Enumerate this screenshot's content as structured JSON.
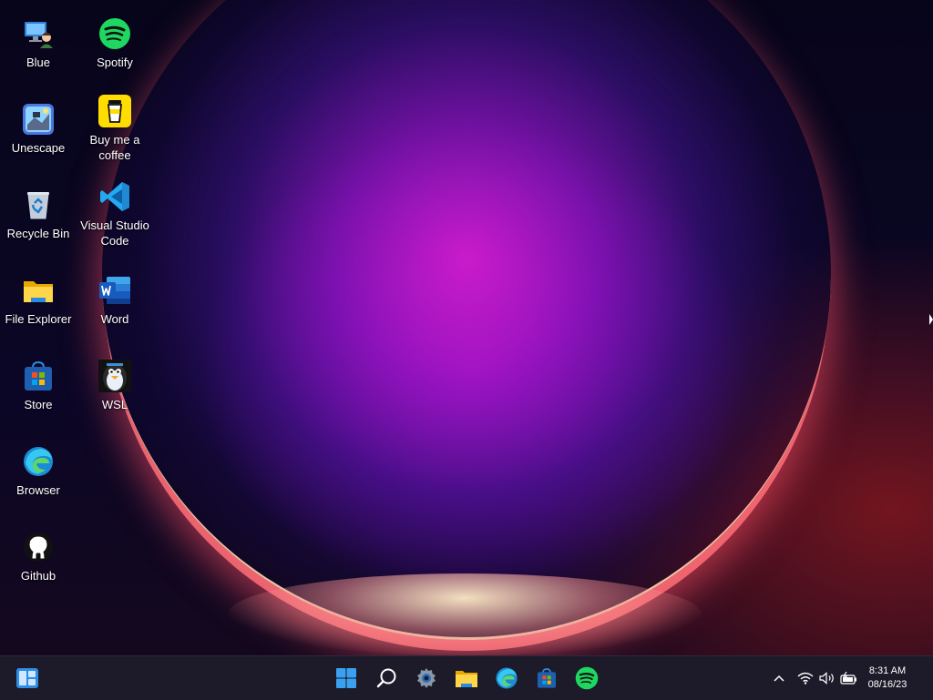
{
  "desktop": {
    "icons": [
      {
        "label": "Blue",
        "icon": "blue-computer-icon"
      },
      {
        "label": "Unescape",
        "icon": "unescape-icon"
      },
      {
        "label": "Recycle Bin",
        "icon": "recycle-bin-icon"
      },
      {
        "label": "File Explorer",
        "icon": "folder-icon"
      },
      {
        "label": "Store",
        "icon": "store-icon"
      },
      {
        "label": "Browser",
        "icon": "edge-icon"
      },
      {
        "label": "Github",
        "icon": "github-icon"
      },
      {
        "label": "Spotify",
        "icon": "spotify-icon"
      },
      {
        "label": "Buy me a coffee",
        "icon": "coffee-icon"
      },
      {
        "label": "Visual Studio Code",
        "icon": "vscode-icon"
      },
      {
        "label": "Word",
        "icon": "word-icon"
      },
      {
        "label": "WSL",
        "icon": "penguin-icon"
      }
    ]
  },
  "taskbar": {
    "apps": [
      "widgets",
      "start",
      "search",
      "settings",
      "file-explorer",
      "edge",
      "store",
      "spotify"
    ],
    "tray": {
      "time": "8:31 AM",
      "date": "08/16/23"
    }
  },
  "colors": {
    "spotify": "#1ed760",
    "coffee": "#ffdd00",
    "vscode": "#23a9f2",
    "word": "#2b579a",
    "taskbar": "#1d1b29",
    "start_blue": "#3aa0f0"
  }
}
